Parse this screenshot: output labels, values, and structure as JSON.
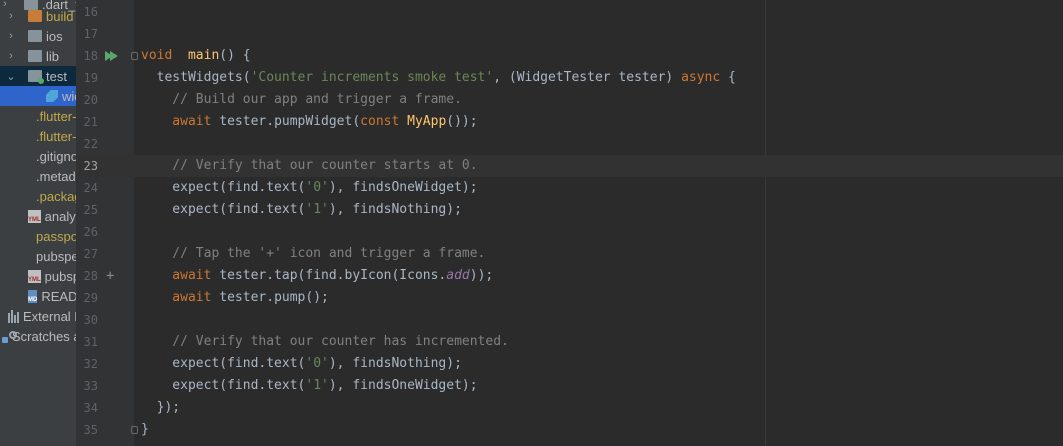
{
  "sidebar": {
    "items": [
      {
        "label": ".dart_tool",
        "kind": "folder",
        "arrow": "›"
      },
      {
        "label": "build",
        "kind": "folder-o",
        "arrow": "›"
      },
      {
        "label": "ios",
        "kind": "folder",
        "arrow": "›"
      },
      {
        "label": "lib",
        "kind": "folder",
        "arrow": "›"
      },
      {
        "label": "test",
        "kind": "folder-g",
        "arrow": "⌄"
      },
      {
        "label": "widget_test.dart",
        "kind": "dart"
      },
      {
        "label": ".flutter-plugins",
        "kind": "doc-yellow"
      },
      {
        "label": ".flutter-plugins-dependencies",
        "kind": "doc-yellow"
      },
      {
        "label": ".gitignore",
        "kind": "doc"
      },
      {
        "label": ".metadata",
        "kind": "doc"
      },
      {
        "label": ".packages",
        "kind": "doc-yellow"
      },
      {
        "label": "analysis_options.yaml",
        "kind": "yml"
      },
      {
        "label": "passport.iml",
        "kind": "doc-yellow"
      },
      {
        "label": "pubspec.lock",
        "kind": "doc"
      },
      {
        "label": "pubspec.yaml",
        "kind": "yml"
      },
      {
        "label": "README.md",
        "kind": "md"
      },
      {
        "label": "External Libraries",
        "kind": "bars"
      },
      {
        "label": "Scratches and Consoles",
        "kind": "scratch"
      }
    ]
  },
  "editor": {
    "current_line": 23,
    "lines": [
      {
        "n": "16",
        "html": ""
      },
      {
        "n": "17",
        "html": ""
      },
      {
        "n": "18",
        "tokens": [
          [
            "kw",
            "void"
          ],
          [
            "",
            "  "
          ],
          [
            "fn",
            "main"
          ],
          [
            "",
            "() {"
          ]
        ]
      },
      {
        "n": "19",
        "tokens": [
          [
            "",
            "  testWidgets("
          ],
          [
            "str",
            "'Counter increments smoke test'"
          ],
          [
            "",
            ", (WidgetTester tester) "
          ],
          [
            "kw",
            "async"
          ],
          [
            "",
            " {"
          ]
        ]
      },
      {
        "n": "20",
        "tokens": [
          [
            "cm",
            "    // Build our app and trigger a frame."
          ]
        ]
      },
      {
        "n": "21",
        "tokens": [
          [
            "kw",
            "    await"
          ],
          [
            "",
            " tester.pumpWidget("
          ],
          [
            "kw",
            "const"
          ],
          [
            "",
            ""
          ],
          [
            "fn",
            " MyApp"
          ],
          [
            "",
            "());"
          ]
        ]
      },
      {
        "n": "22",
        "tokens": []
      },
      {
        "n": "23",
        "tokens": [
          [
            "cm",
            "    // Verify that our counter starts at 0."
          ]
        ]
      },
      {
        "n": "24",
        "tokens": [
          [
            "",
            "    expect(find.text("
          ],
          [
            "str",
            "'0'"
          ],
          [
            "",
            "), findsOneWidget);"
          ]
        ]
      },
      {
        "n": "25",
        "tokens": [
          [
            "",
            "    expect(find.text("
          ],
          [
            "str",
            "'1'"
          ],
          [
            "",
            "), findsNothing);"
          ]
        ]
      },
      {
        "n": "26",
        "tokens": []
      },
      {
        "n": "27",
        "tokens": [
          [
            "cm",
            "    // Tap the '+' icon and trigger a frame."
          ]
        ]
      },
      {
        "n": "28",
        "tokens": [
          [
            "kw",
            "    await"
          ],
          [
            "",
            " tester.tap(find.byIcon(Icons."
          ],
          [
            "it",
            "add"
          ],
          [
            "",
            "));"
          ]
        ]
      },
      {
        "n": "29",
        "tokens": [
          [
            "kw",
            "    await"
          ],
          [
            "",
            " tester.pump();"
          ]
        ]
      },
      {
        "n": "30",
        "tokens": []
      },
      {
        "n": "31",
        "tokens": [
          [
            "cm",
            "    // Verify that our counter has incremented."
          ]
        ]
      },
      {
        "n": "32",
        "tokens": [
          [
            "",
            "    expect(find.text("
          ],
          [
            "str",
            "'0'"
          ],
          [
            "",
            "), findsNothing);"
          ]
        ]
      },
      {
        "n": "33",
        "tokens": [
          [
            "",
            "    expect(find.text("
          ],
          [
            "str",
            "'1'"
          ],
          [
            "",
            "), findsOneWidget);"
          ]
        ]
      },
      {
        "n": "34",
        "tokens": [
          [
            "",
            "  });"
          ]
        ]
      },
      {
        "n": "35",
        "tokens": [
          [
            "",
            "}"
          ]
        ]
      }
    ]
  },
  "gutter": {
    "run_icon": "run-triangle-icon",
    "add_icon_line": "28"
  },
  "colors": {
    "keyword": "#cc7832",
    "function": "#ffc66d",
    "string": "#6a8759",
    "comment": "#808080",
    "text": "#a9b7c6"
  }
}
